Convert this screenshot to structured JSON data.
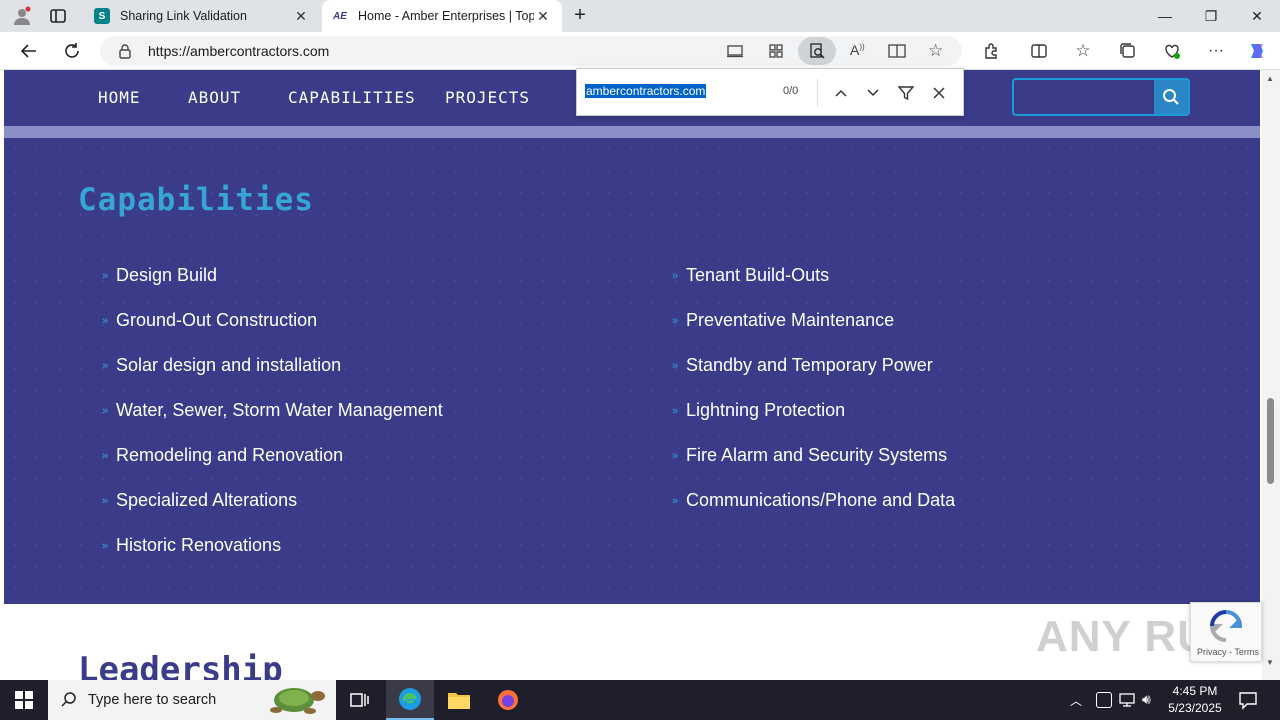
{
  "browser": {
    "tabs": [
      {
        "title": "Sharing Link Validation",
        "icon_letter": "S",
        "icon_color": "#038387"
      },
      {
        "title": "Home - Amber Enterprises | Top-",
        "icon_letter": "AE",
        "icon_color": "#3a3c8a"
      }
    ],
    "url": "https://ambercontractors.com"
  },
  "findbar": {
    "query": "ambercontractors.com",
    "count": "0/0"
  },
  "site": {
    "nav": [
      "HOME",
      "ABOUT",
      "CAPABILITIES",
      "PROJECTS"
    ],
    "capabilities_title": "Capabilities",
    "capabilities_left": [
      "Design Build",
      "Ground-Out Construction",
      "Solar design and installation",
      "Water, Sewer, Storm Water Management",
      "Remodeling and Renovation",
      "Specialized Alterations",
      "Historic Renovations"
    ],
    "capabilities_right": [
      "Tenant Build-Outs",
      "Preventative Maintenance",
      "Standby and Temporary Power",
      "Lightning Protection",
      "Fire Alarm and Security Systems",
      "Communications/Phone and Data"
    ],
    "leadership_title": "Leadership"
  },
  "recaptcha": {
    "text": "Privacy - Terms"
  },
  "watermark": "ANY RUN",
  "taskbar": {
    "search_placeholder": "Type here to search",
    "time": "4:45 PM",
    "date": "5/23/2025"
  },
  "colors": {
    "site_primary": "#3a3c8a",
    "accent": "#37a6d6"
  }
}
